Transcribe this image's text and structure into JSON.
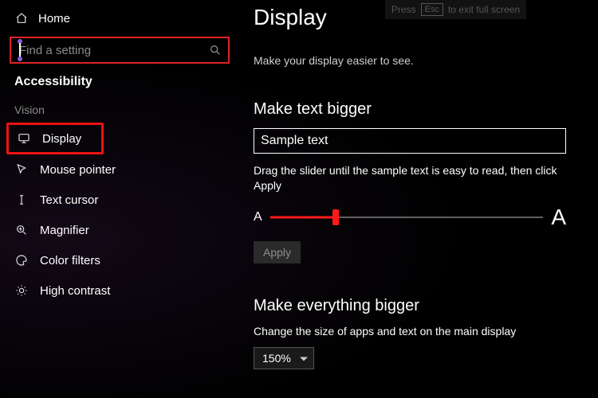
{
  "sidebar": {
    "home_label": "Home",
    "search_placeholder": "Find a setting",
    "section_title": "Accessibility",
    "group_label": "Vision",
    "items": [
      {
        "label": "Display"
      },
      {
        "label": "Mouse pointer"
      },
      {
        "label": "Text cursor"
      },
      {
        "label": "Magnifier"
      },
      {
        "label": "Color filters"
      },
      {
        "label": "High contrast"
      }
    ]
  },
  "esc_hint": {
    "pre": "Press",
    "key": "Esc",
    "post": "to exit full screen"
  },
  "main": {
    "title": "Display",
    "subtitle": "Make your display easier to see.",
    "text_section": {
      "heading": "Make text bigger",
      "sample": "Sample text",
      "description": "Drag the slider until the sample text is easy to read, then click Apply",
      "small_a": "A",
      "big_a": "A",
      "apply_label": "Apply"
    },
    "everything_section": {
      "heading": "Make everything bigger",
      "description": "Change the size of apps and text on the main display",
      "selected": "150%"
    }
  }
}
